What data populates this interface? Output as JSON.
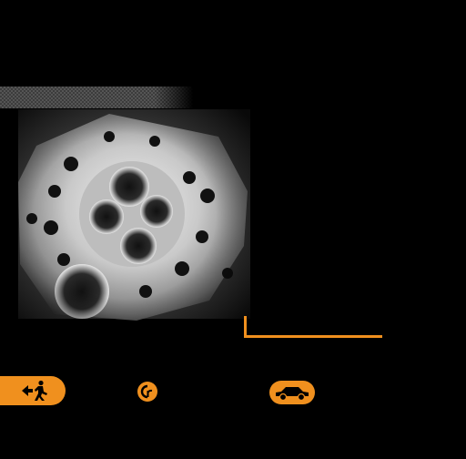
{
  "colors": {
    "accent": "#f0901e",
    "background": "#000000"
  },
  "images": {
    "engine": "engine-cylinder-head-photo"
  },
  "buttons": {
    "exit_icon": "exit-running-man-icon",
    "credits_icon": "credits-cr-icon",
    "car_icon": "car-icon"
  }
}
